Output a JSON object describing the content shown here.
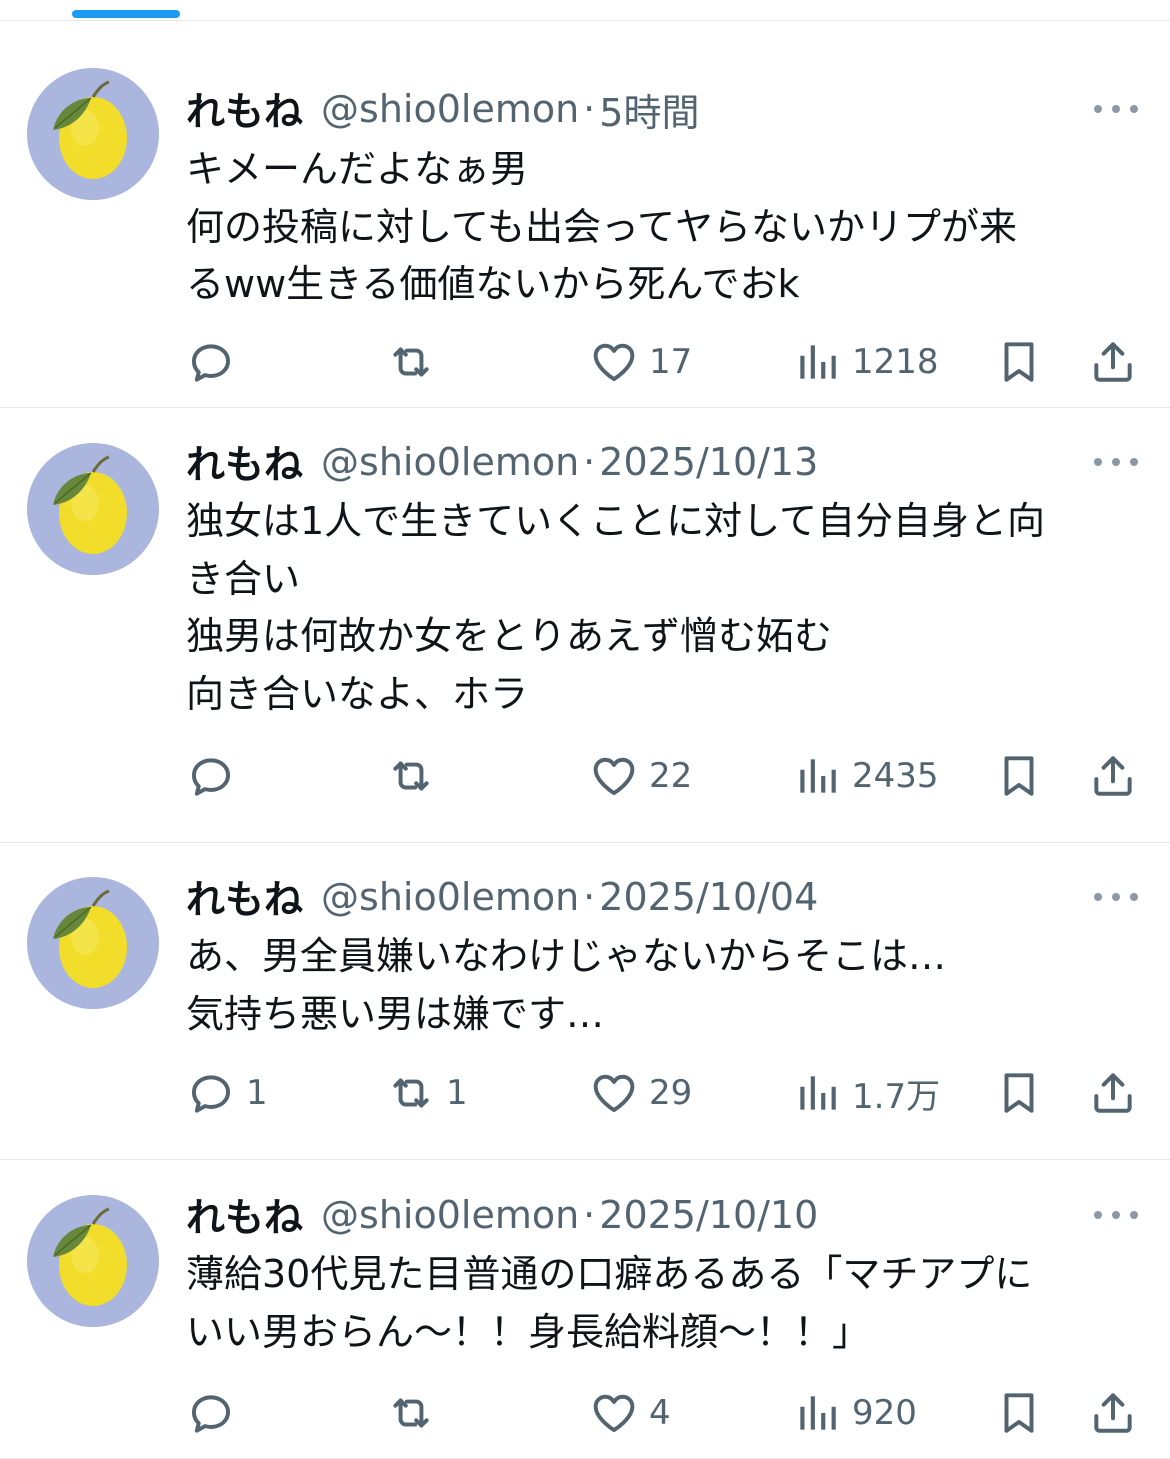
{
  "colors": {
    "accent": "#1d9bf0",
    "icon": "#536471",
    "text": "#0f1419",
    "border": "#e6e9ec"
  },
  "tweets": [
    {
      "name": "れもね",
      "handle": "@shio0lemon",
      "dot": "·",
      "time": "5時間",
      "lines": [
        "キメーんだよなぁ男",
        "何の投稿に対しても出会ってヤらないかリプが来",
        "るww生きる価値ないから死んでおk"
      ],
      "replies": "",
      "retweets": "",
      "likes": "17",
      "views": "1218"
    },
    {
      "name": "れもね",
      "handle": "@shio0lemon",
      "dot": "·",
      "time": "2025/10/13",
      "lines": [
        "独女は1人で生きていくことに対して自分自身と向",
        "き合い",
        "独男は何故か女をとりあえず憎む妬む",
        "向き合いなよ、ホラ"
      ],
      "replies": "",
      "retweets": "",
      "likes": "22",
      "views": "2435"
    },
    {
      "name": "れもね",
      "handle": "@shio0lemon",
      "dot": "·",
      "time": "2025/10/04",
      "lines": [
        "あ、男全員嫌いなわけじゃないからそこは…",
        "気持ち悪い男は嫌です…"
      ],
      "replies": "1",
      "retweets": "1",
      "likes": "29",
      "views": "1.7万"
    },
    {
      "name": "れもね",
      "handle": "@shio0lemon",
      "dot": "·",
      "time": "2025/10/10",
      "lines": [
        "薄給30代見た目普通の口癖あるある「マチアプに",
        "いい男おらん〜！！身長給料顔〜！！」"
      ],
      "replies": "",
      "retweets": "",
      "likes": "4",
      "views": "920"
    }
  ]
}
